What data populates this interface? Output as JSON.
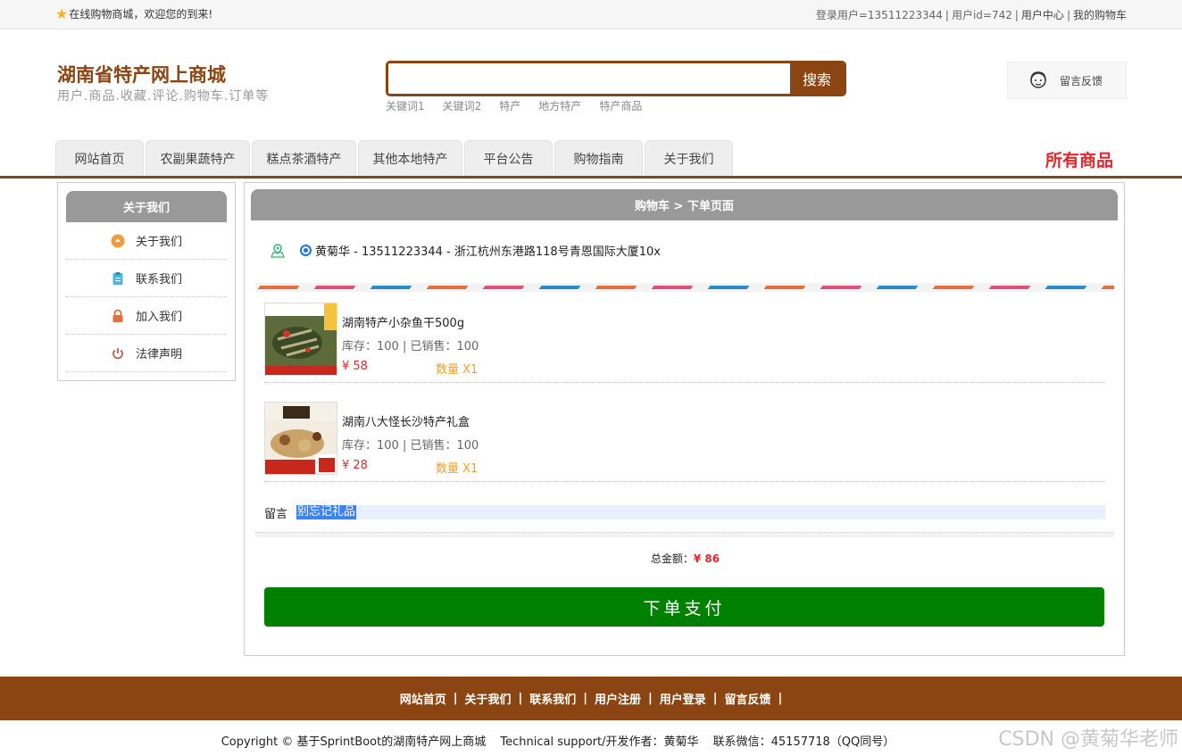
{
  "topbar": {
    "welcome": "在线购物商城，欢迎您的到来!",
    "user": "登录用户=13511223344",
    "uid": "用户id=742",
    "center": "用户中心",
    "cart": "我的购物车"
  },
  "header": {
    "title": "湖南省特产网上商城",
    "subtitle": "用户.商品.收藏.评论.购物车.订单等",
    "search_placeholder": "",
    "search_button": "搜索",
    "keywords": [
      "关键词1",
      "关键词2",
      "特产",
      "地方特产",
      "特产商品"
    ],
    "feedback": "留言反馈"
  },
  "nav": {
    "tabs": [
      "网站首页",
      "农副果蔬特产",
      "糕点茶酒特产",
      "其他本地特产",
      "平台公告",
      "购物指南",
      "关于我们"
    ],
    "all_goods": "所有商品"
  },
  "sidebar": {
    "title": "关于我们",
    "items": [
      "关于我们",
      "联系我们",
      "加入我们",
      "法律声明"
    ]
  },
  "main": {
    "breadcrumb": "购物车 > 下单页面",
    "address": "黄菊华 - 13511223344 - 浙江杭州东港路118号青恩国际大厦10x",
    "items": [
      {
        "name": "湖南特产小杂鱼干500g",
        "stock": "库存：100 | 已销售：100",
        "price": "¥ 58",
        "qty": "数量 X1"
      },
      {
        "name": "湖南八大怪长沙特产礼盒",
        "stock": "库存：100 | 已销售：100",
        "price": "¥ 28",
        "qty": "数量 X1"
      }
    ],
    "note_label": "留言",
    "note_value": "别忘记礼品",
    "total_label": "总金额：",
    "total_value": "¥ 86",
    "pay_button": "下单支付"
  },
  "footer": {
    "links": [
      "网站首页",
      "关于我们",
      "联系我们",
      "用户注册",
      "用户登录",
      "留言反馈"
    ],
    "copyright": "Copyright © 基于SprintBoot的湖南特产网上商城",
    "support": "Technical support/开发作者：黄菊华",
    "contact": "联系微信：45157718（QQ同号）",
    "watermark": "CSDN @黄菊华老师"
  },
  "colors": {
    "brand": "#8b4513",
    "accent_red": "#e8262d",
    "pay_green": "#008000",
    "qty_orange": "#f0a020"
  }
}
